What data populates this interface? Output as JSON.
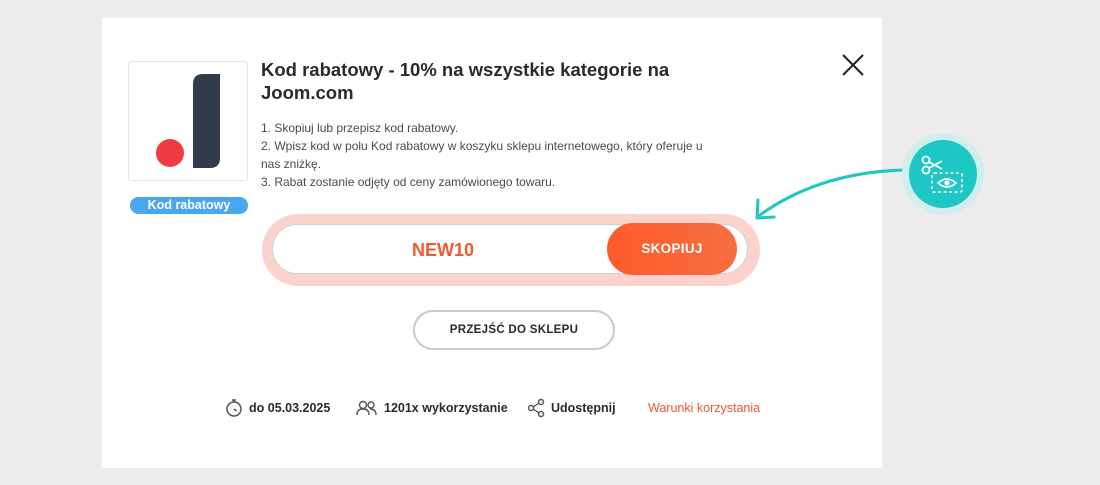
{
  "coupon": {
    "title": "Kod rabatowy - 10% na wszystkie kategorie na Joom.com",
    "badge": "Kod rabatowy",
    "steps": [
      "1. Skopiuj lub przepisz kod rabatowy.",
      "2. Wpisz kod w polu Kod rabatowy w koszyku sklepu internetowego, który oferuje u nas zniżkę.",
      "3. Rabat zostanie odjęty od ceny zamówionego towaru."
    ],
    "code": "NEW10",
    "copy_label": "SKOPIUJ",
    "shop_label": "PRZEJŚĆ DO SKLEPU"
  },
  "meta": {
    "expires": "do 05.03.2025",
    "usage": "1201x wykorzystanie",
    "share": "Udostępnij",
    "terms": "Warunki korzystania"
  },
  "colors": {
    "accent": "#f0582d",
    "badge": "#4aa7ee",
    "teal": "#1ec7c3"
  },
  "icons": {
    "close": "close-icon",
    "timer": "stopwatch-icon",
    "users": "users-icon",
    "share": "share-icon",
    "scissors": "scissors-coupon-icon"
  }
}
